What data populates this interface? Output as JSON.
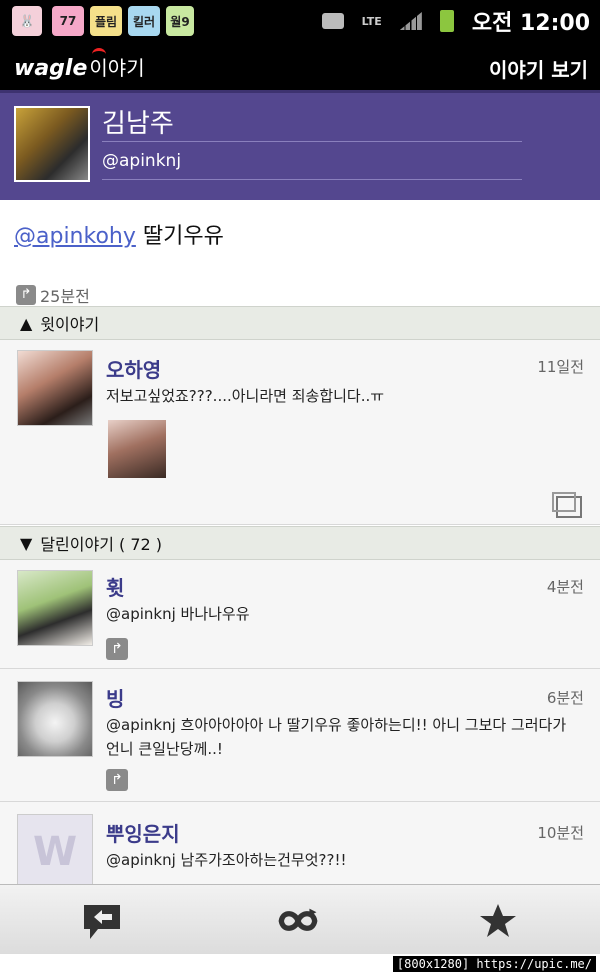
{
  "status_bar": {
    "notifications": [
      "77",
      "플림",
      "킬러",
      "월9"
    ],
    "network": "LTE",
    "time": "오전 12:00"
  },
  "app_bar": {
    "logo": "wagle",
    "logo_sub": "이야기",
    "title": "이야기 보기"
  },
  "profile": {
    "name": "김남주",
    "handle": "@apinknj"
  },
  "post": {
    "mention": "@apinkohy",
    "text": "딸기우유",
    "time": "25분전"
  },
  "sections": {
    "above": "윗이야기",
    "replies": "달린이야기 ( 72 )"
  },
  "parent": {
    "name": "오하영",
    "time": "11일전",
    "text": "저보고싶었죠???....아니라면 죄송합니다..ㅠ"
  },
  "replies": [
    {
      "name": "휫",
      "time": "4분전",
      "text": "@apinknj 바나나우유"
    },
    {
      "name": "빙",
      "time": "6분전",
      "text": "@apinknj 흐아아아아아 나 딸기우유 좋아하는디!!  아니 그보다 그러다가 언니 큰일난당께..!"
    },
    {
      "name": "뿌잉은지",
      "time": "10분전",
      "text": "@apinknj 남주가조아하는건무엇??!!"
    }
  ],
  "bottom_bar": [
    "reply-icon",
    "retweet-icon",
    "star-icon"
  ],
  "watermark": "[800x1280] https://upic.me/",
  "colors": {
    "header": "#54478f",
    "name": "#3b3b8a",
    "mention": "#4b61c9"
  }
}
